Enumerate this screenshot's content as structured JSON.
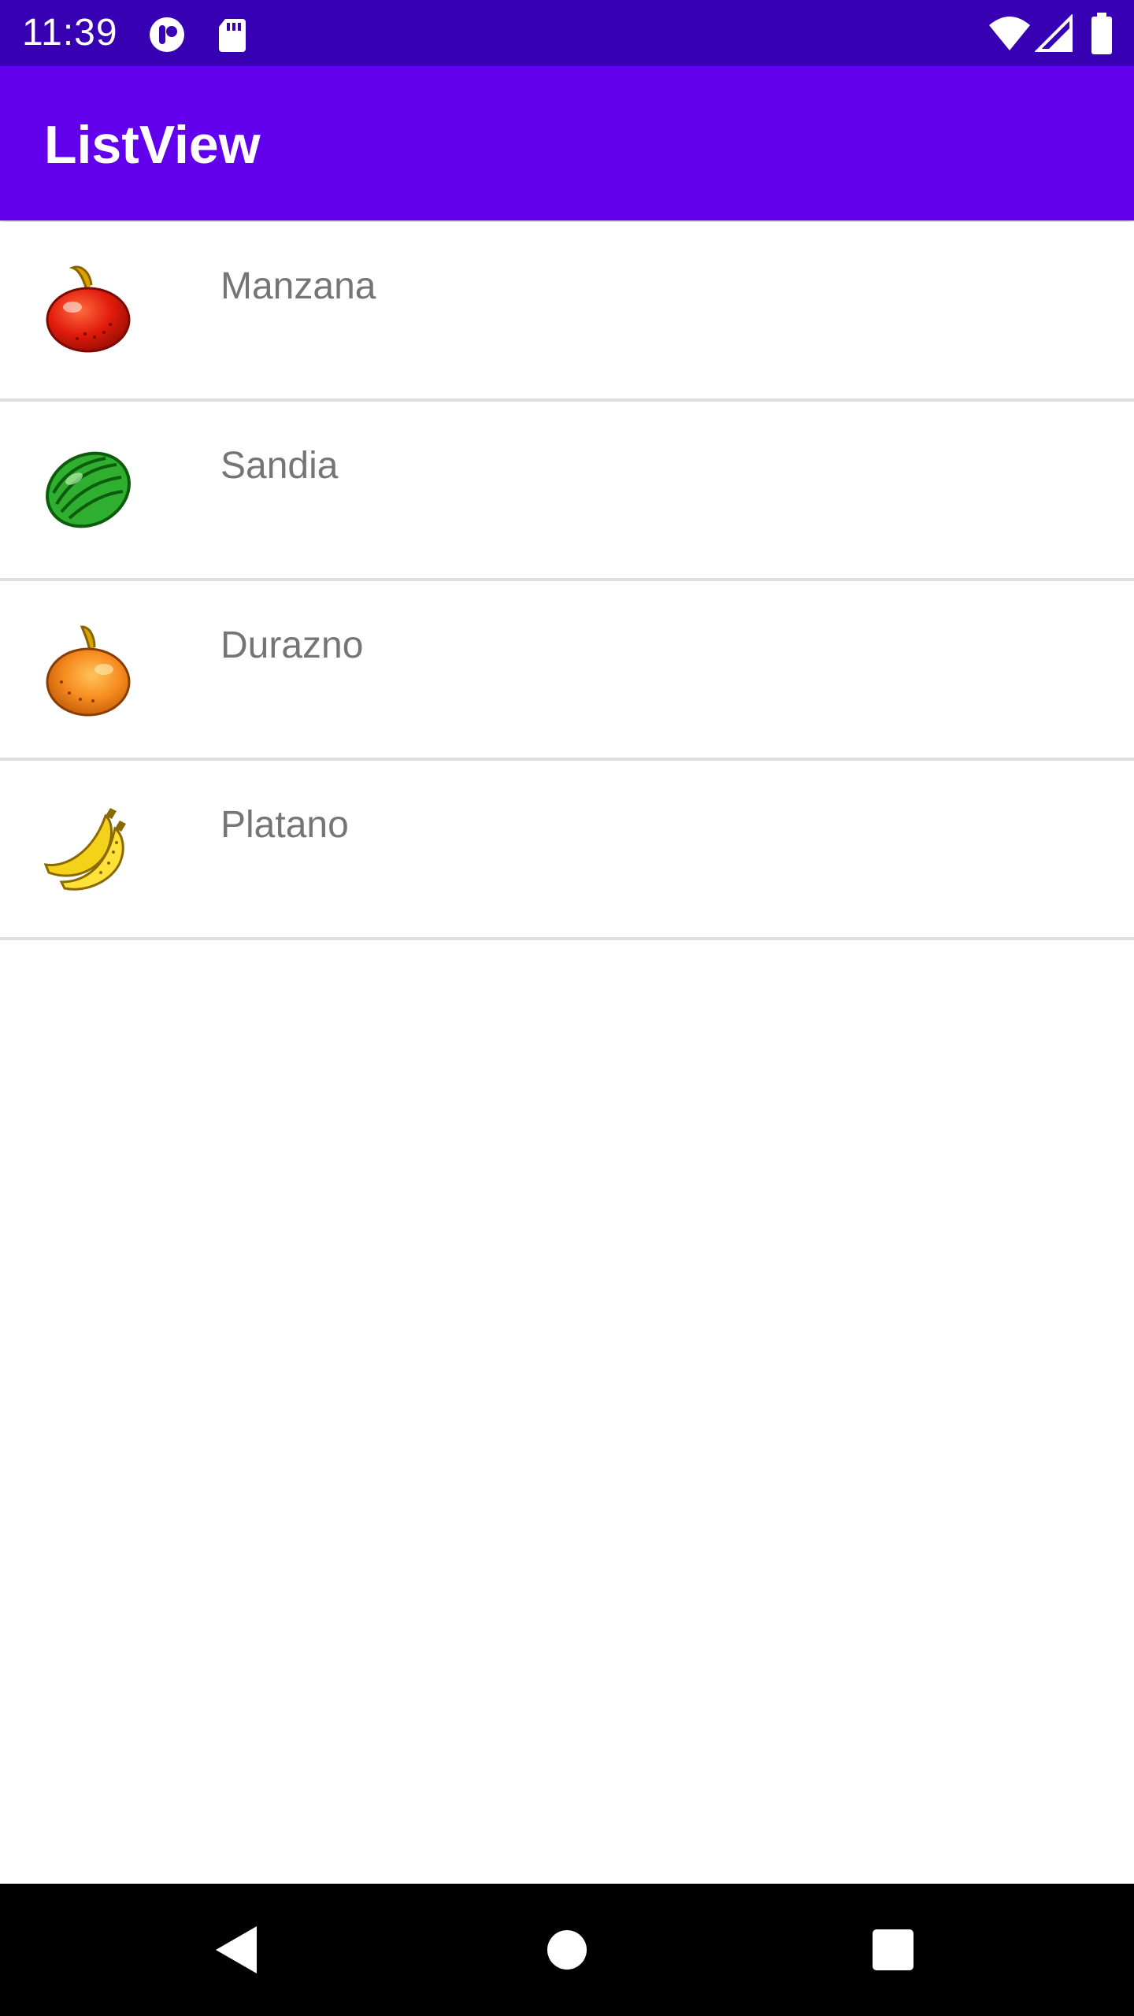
{
  "status_bar": {
    "time": "11:39",
    "icons": [
      "notification-icon",
      "sd-card-icon",
      "wifi-icon",
      "signal-icon",
      "battery-icon"
    ],
    "background": "#3700b3"
  },
  "app_bar": {
    "title": "ListView",
    "background": "#6200ee"
  },
  "list": {
    "items": [
      {
        "label": "Manzana",
        "icon": "apple-icon"
      },
      {
        "label": "Sandia",
        "icon": "watermelon-icon"
      },
      {
        "label": "Durazno",
        "icon": "peach-icon"
      },
      {
        "label": "Platano",
        "icon": "banana-icon"
      }
    ]
  },
  "nav_bar": {
    "buttons": [
      "back-icon",
      "home-icon",
      "recents-icon"
    ]
  }
}
